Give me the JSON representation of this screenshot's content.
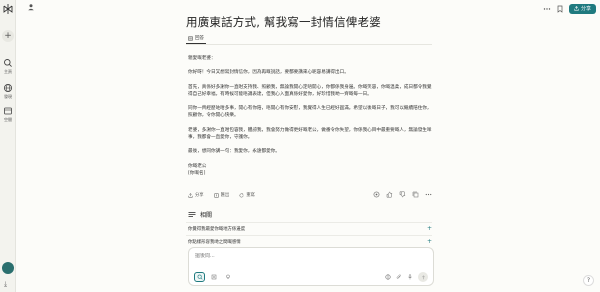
{
  "sidebar": {
    "items": [
      {
        "label": "主頁",
        "icon": "search-icon"
      },
      {
        "label": "發現",
        "icon": "globe-icon"
      },
      {
        "label": "空間",
        "icon": "library-icon"
      }
    ]
  },
  "topbar": {
    "share_label": "分享"
  },
  "thread": {
    "title": "用廣東話方式, 幫我寫一封情信俾老婆",
    "tab_answer": "回答"
  },
  "letter": {
    "greeting": "親愛嘅老婆：",
    "p1": "你好呀！今日又想寫封情信你，因為再嘅說話，要都要講來心呢容易講得出口。",
    "p2": "首先，真係好多謝你一直咁支持我、照顧我，無論我開心定唔開心，你都係我身邊。你嘅笑容，你嘅溫柔，成日都令我覺得自己好幸福，有時候可能唔識表達，但我心入面真係好愛你，好珍惜我哋一齊嘅每一日。",
    "p3": "同你一齊經歷咗咁多事，開心有你陪，唔開心有你安慰，我覺得人生已經好圓滿。希望以後嘅日子，我可以繼續陪住你，照顧你，令你開心快樂。",
    "p4": "老婆，多謝你一直咁包容我，體諒我，我會努力做得更好嘅老公，做番令你失望，你係我心目中最重要嘅人，無論發生咩事，我都會一直愛你，守護你。",
    "p5": "最後，想同你講一句：我愛你，永遠都愛你。",
    "sign1": "你嘅老公",
    "sign2": "[你嘅名]"
  },
  "actions": {
    "share": "分享",
    "export": "匯出",
    "rewrite": "重寫"
  },
  "related": {
    "heading": "相關",
    "items": [
      "你覺得我最愛你嘅地方係邊度",
      "你點樣形容我哋之間嘅感情"
    ]
  },
  "composer": {
    "placeholder": "搵後問..."
  },
  "colors": {
    "accent": "#1f7a7f",
    "background": "#fcfcf9"
  }
}
